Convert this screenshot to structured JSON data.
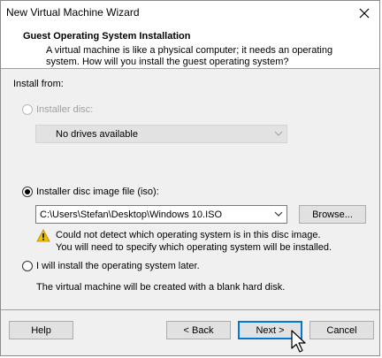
{
  "window": {
    "title": "New Virtual Machine Wizard"
  },
  "header": {
    "title": "Guest Operating System Installation",
    "description": "A virtual machine is like a physical computer; it needs an operating system. How will you install the guest operating system?"
  },
  "install_from": {
    "label": "Install from:",
    "options": [
      {
        "label": "Installer disc:",
        "selected": false,
        "enabled": false
      },
      {
        "label": "Installer disc image file (iso):",
        "selected": true,
        "enabled": true
      },
      {
        "label": "I will install the operating system later.",
        "selected": false,
        "enabled": true
      }
    ],
    "disc_dropdown_value": "No drives available",
    "iso_path_value": "C:\\Users\\Stefan\\Desktop\\Windows 10.ISO",
    "browse_label": "Browse...",
    "warning_line1": "Could not detect which operating system is in this disc image.",
    "warning_line2": "You will need to specify which operating system will be installed.",
    "later_note": "The virtual machine will be created with a blank hard disk."
  },
  "footer": {
    "help_label": "Help",
    "back_label": "< Back",
    "next_label": "Next >",
    "cancel_label": "Cancel"
  },
  "colors": {
    "accent": "#0078d7",
    "warning": "#f2c200"
  }
}
